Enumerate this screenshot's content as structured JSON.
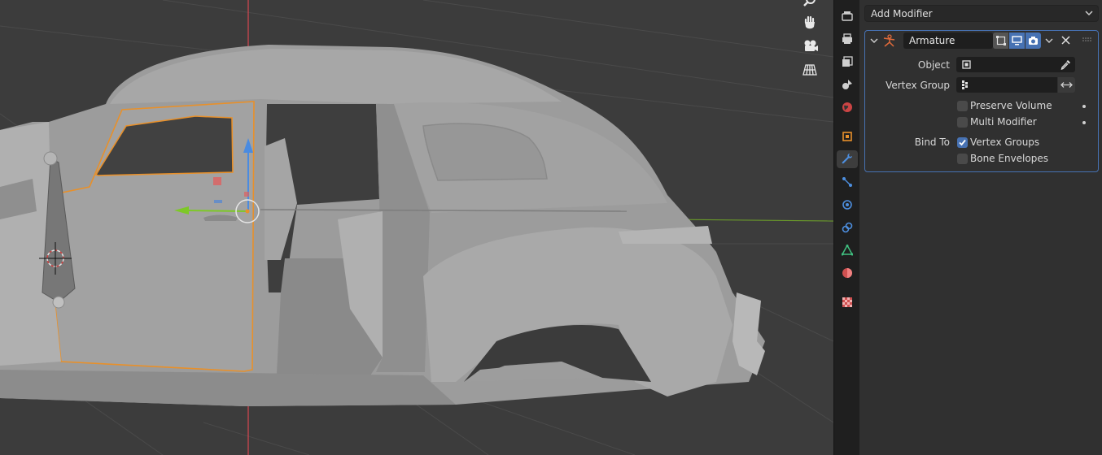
{
  "properties": {
    "add_modifier_label": "Add Modifier",
    "modifier": {
      "name": "Armature",
      "object_label": "Object",
      "object_value": "",
      "vertex_group_label": "Vertex Group",
      "vertex_group_value": "",
      "options": [
        {
          "label": "Preserve Volume",
          "checked": false
        },
        {
          "label": "Multi Modifier",
          "checked": false
        }
      ],
      "bind_to_label": "Bind To",
      "bind_options": [
        {
          "label": "Vertex Groups",
          "checked": true
        },
        {
          "label": "Bone Envelopes",
          "checked": false
        }
      ]
    }
  },
  "colors": {
    "selection_outline": "#e8902a",
    "panel_accent": "#4772b3",
    "toggle_active": "#4772b3",
    "axis_x": "#e24f4f",
    "axis_y": "#7ec828",
    "axis_z": "#4a8be0"
  },
  "icons": {
    "viewport_nav": [
      "zoom-icon",
      "hand-pan-icon",
      "camera-icon",
      "grid-perspective-icon"
    ],
    "property_tabs": [
      "render-icon",
      "output-icon",
      "view-layer-icon",
      "scene-icon",
      "world-icon",
      "object-icon",
      "modifier-wrench-icon",
      "particles-icon",
      "physics-icon",
      "constraints-icon",
      "object-data-icon",
      "material-icon",
      "texture-icon"
    ]
  }
}
